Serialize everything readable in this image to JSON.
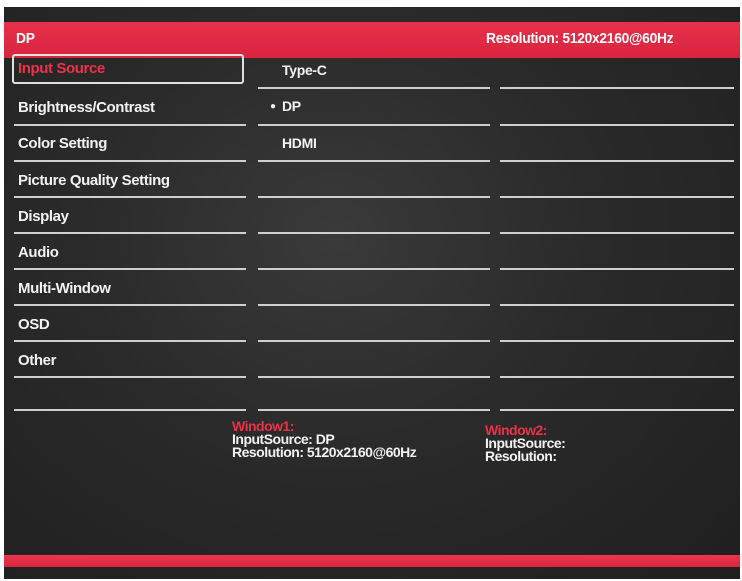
{
  "header": {
    "source": "DP",
    "resolution": "Resolution:  5120x2160@60Hz"
  },
  "menu": {
    "items": [
      {
        "label": "Input Source",
        "selected": true
      },
      {
        "label": "Brightness/Contrast"
      },
      {
        "label": "Color Setting"
      },
      {
        "label": "Picture Quality Setting"
      },
      {
        "label": "Display"
      },
      {
        "label": "Audio"
      },
      {
        "label": "Multi-Window"
      },
      {
        "label": "OSD"
      },
      {
        "label": "Other"
      }
    ]
  },
  "options": {
    "items": [
      {
        "label": "Type-C",
        "checked": false
      },
      {
        "label": "DP",
        "checked": true
      },
      {
        "label": "HDMI",
        "checked": false
      }
    ]
  },
  "window1": {
    "title": "Window1:",
    "input_source": "InputSource:  DP",
    "resolution": "Resolution:  5120x2160@60Hz"
  },
  "window2": {
    "title": "Window2:",
    "input_source": "InputSource:",
    "resolution": "Resolution:"
  },
  "colors": {
    "accent": "#e8304a",
    "background": "#2a2a2a",
    "text": "#f2f2f2"
  }
}
